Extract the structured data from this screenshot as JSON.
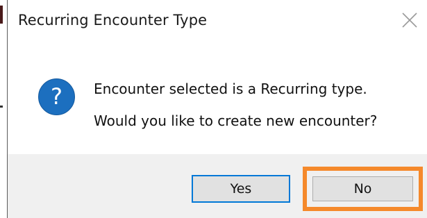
{
  "dialog": {
    "title": "Recurring Encounter Type",
    "message_line1": "Encounter selected is a Recurring type.",
    "message_line2": "Would you like to create new encounter?",
    "icon": "question-icon",
    "close_icon": "close-icon"
  },
  "buttons": {
    "yes_label": "Yes",
    "no_label": "No"
  },
  "colors": {
    "icon_blue": "#1c6fbf",
    "focus_border": "#0078d7",
    "highlight_orange": "#f5892b",
    "footer_bg": "#f0f0f0",
    "button_bg": "#e1e1e1"
  }
}
